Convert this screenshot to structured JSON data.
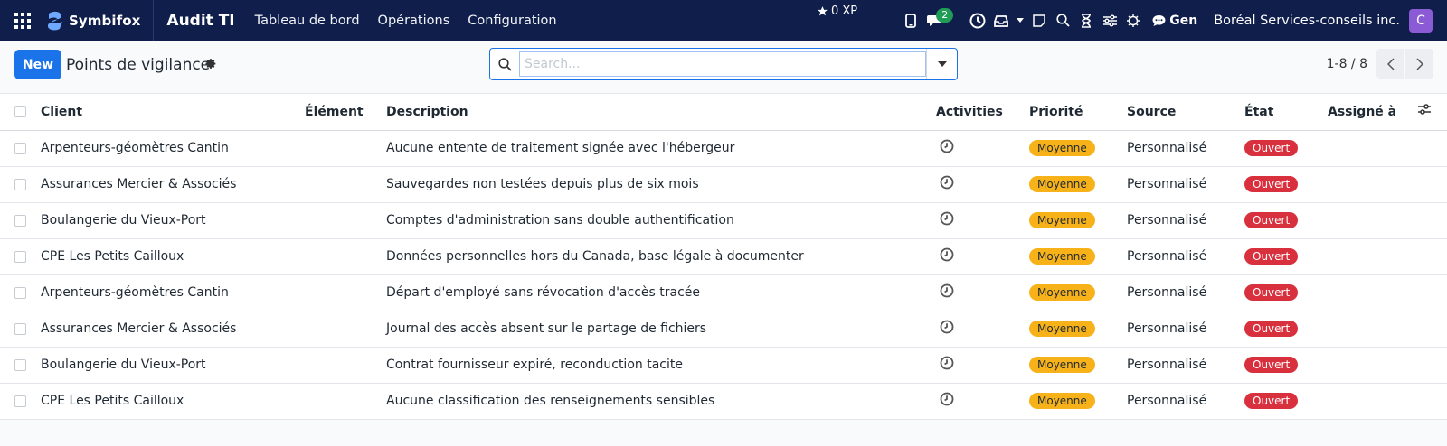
{
  "navbar": {
    "logo_text": "Symbifox",
    "app_title": "Audit TI",
    "menu": [
      "Tableau de bord",
      "Opérations",
      "Configuration"
    ],
    "xp": "0 XP",
    "chat_count": "2",
    "gen_label": "Gen",
    "company": "Boréal Services-conseils inc.",
    "avatar_letter": "C"
  },
  "control": {
    "new_label": "New",
    "title": "Points de vigilance",
    "search_placeholder": "Search...",
    "pager": "1-8 / 8"
  },
  "table": {
    "columns": [
      "Client",
      "Élément",
      "Description",
      "Activities",
      "Priorité",
      "Source",
      "État",
      "Assigné à"
    ],
    "rows": [
      {
        "client": "Arpenteurs-géomètres Cantin",
        "element": "",
        "description": "Aucune entente de traitement signée avec l'hébergeur",
        "priority": "Moyenne",
        "source": "Personnalisé",
        "state": "Ouvert",
        "assignee": ""
      },
      {
        "client": "Assurances Mercier & Associés",
        "element": "",
        "description": "Sauvegardes non testées depuis plus de six mois",
        "priority": "Moyenne",
        "source": "Personnalisé",
        "state": "Ouvert",
        "assignee": ""
      },
      {
        "client": "Boulangerie du Vieux-Port",
        "element": "",
        "description": "Comptes d'administration sans double authentification",
        "priority": "Moyenne",
        "source": "Personnalisé",
        "state": "Ouvert",
        "assignee": ""
      },
      {
        "client": "CPE Les Petits Cailloux",
        "element": "",
        "description": "Données personnelles hors du Canada, base légale à documenter",
        "priority": "Moyenne",
        "source": "Personnalisé",
        "state": "Ouvert",
        "assignee": ""
      },
      {
        "client": "Arpenteurs-géomètres Cantin",
        "element": "",
        "description": "Départ d'employé sans révocation d'accès tracée",
        "priority": "Moyenne",
        "source": "Personnalisé",
        "state": "Ouvert",
        "assignee": ""
      },
      {
        "client": "Assurances Mercier & Associés",
        "element": "",
        "description": "Journal des accès absent sur le partage de fichiers",
        "priority": "Moyenne",
        "source": "Personnalisé",
        "state": "Ouvert",
        "assignee": ""
      },
      {
        "client": "Boulangerie du Vieux-Port",
        "element": "",
        "description": "Contrat fournisseur expiré, reconduction tacite",
        "priority": "Moyenne",
        "source": "Personnalisé",
        "state": "Ouvert",
        "assignee": ""
      },
      {
        "client": "CPE Les Petits Cailloux",
        "element": "",
        "description": "Aucune classification des renseignements sensibles",
        "priority": "Moyenne",
        "source": "Personnalisé",
        "state": "Ouvert",
        "assignee": ""
      }
    ]
  },
  "colors": {
    "navbar_bg": "#0f1e4a",
    "primary": "#1a73e8",
    "priority_medium": "#f7b21a",
    "state_open": "#d9303e",
    "avatar_bg": "#8b5bd6"
  }
}
